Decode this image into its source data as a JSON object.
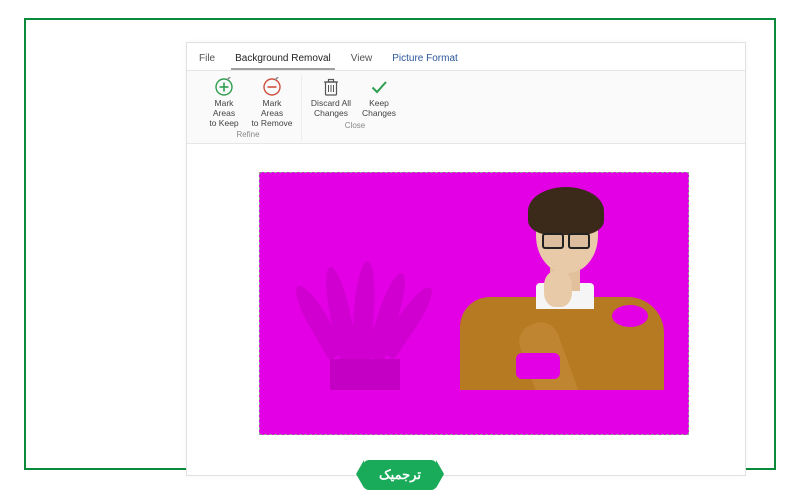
{
  "tabs": {
    "file": "File",
    "bg_removal": "Background Removal",
    "view": "View",
    "picture_format": "Picture Format"
  },
  "ribbon": {
    "refine": {
      "label": "Refine",
      "mark_keep": {
        "l1": "Mark Areas",
        "l2": "to Keep"
      },
      "mark_remove": {
        "l1": "Mark Areas",
        "l2": "to Remove"
      }
    },
    "close": {
      "label": "Close",
      "discard": {
        "l1": "Discard All",
        "l2": "Changes"
      },
      "keep": {
        "l1": "Keep",
        "l2": "Changes"
      }
    }
  },
  "colors": {
    "removal_mask": "#e400e4",
    "frame_border": "#0a8a3a",
    "watermark_bg": "#1aab5a"
  },
  "watermark": "ترجمیک"
}
